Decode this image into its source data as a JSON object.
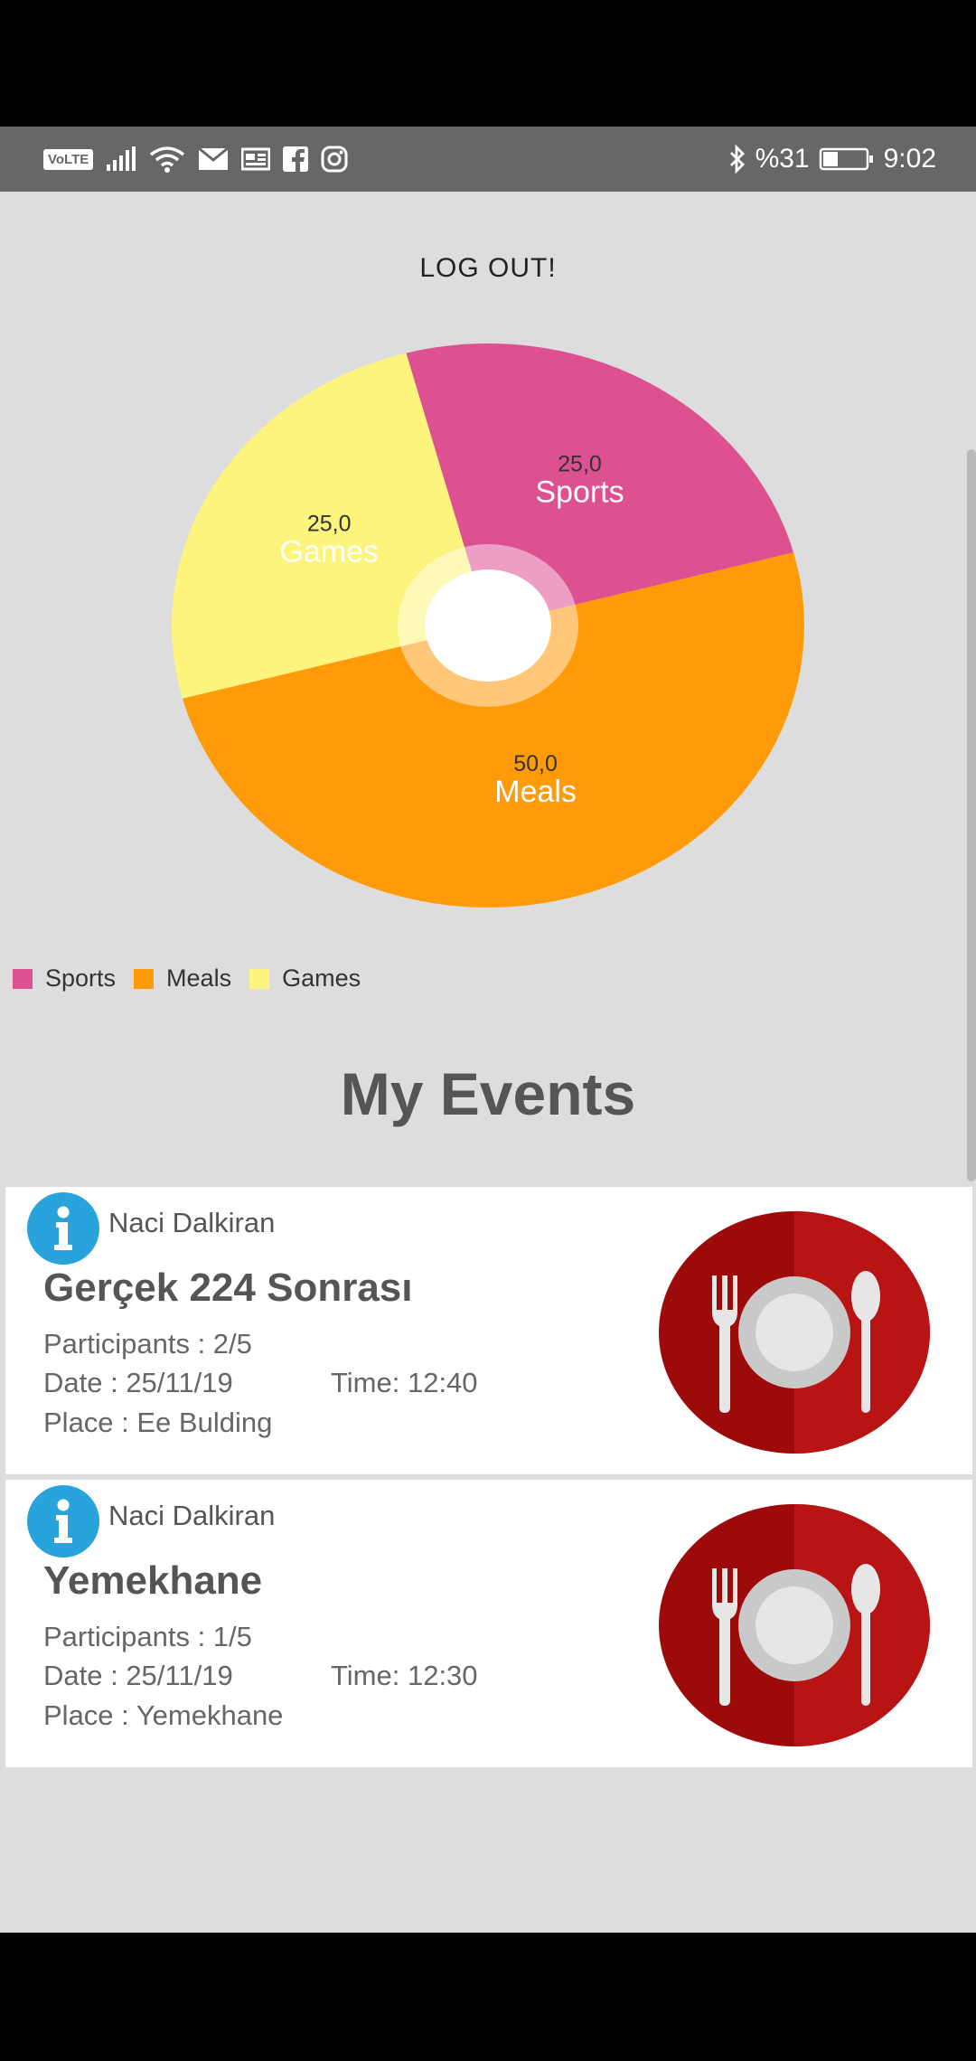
{
  "status_bar": {
    "volte": "VoLTE",
    "battery_percent": "%31",
    "time": "9:02",
    "left_icons": [
      "signal-icon",
      "wifi-icon",
      "mail-icon",
      "news-icon",
      "facebook-icon",
      "instagram-icon"
    ],
    "right_icons": [
      "bluetooth-icon",
      "battery-icon"
    ]
  },
  "header": {
    "logout_label": "LOG OUT!"
  },
  "chart_data": {
    "type": "pie",
    "categories": [
      "Sports",
      "Meals",
      "Games"
    ],
    "values": [
      25.0,
      50.0,
      25.0
    ],
    "value_labels": [
      "25,0",
      "50,0",
      "25,0"
    ],
    "colors": [
      "#dd5190",
      "#ff9a08",
      "#fdf47d"
    ],
    "legend_position": "bottom-left",
    "donut_hole": true
  },
  "legend": {
    "items": [
      {
        "label": "Sports",
        "color": "#dd5190"
      },
      {
        "label": "Meals",
        "color": "#ff9a08"
      },
      {
        "label": "Games",
        "color": "#fdf47d"
      }
    ]
  },
  "events_section": {
    "title": "My Events",
    "events": [
      {
        "organizer": "Naci Dalkiran",
        "title": "Gerçek 224 Sonrası",
        "participants": "Participants : 2/5",
        "date": "Date : 25/11/19",
        "time": "Time: 12:40",
        "place": "Place : Ee Bulding",
        "icon": "meal-plate-icon"
      },
      {
        "organizer": "Naci Dalkiran",
        "title": "Yemekhane",
        "participants": "Participants : 1/5",
        "date": "Date : 25/11/19",
        "time": "Time: 12:30",
        "place": "Place : Yemekhane",
        "icon": "meal-plate-icon"
      }
    ]
  },
  "colors": {
    "status_bar": "#676767",
    "background": "#dddddd",
    "card": "#ffffff",
    "info_icon": "#29a3dc",
    "plate_dark": "#9c0a0a",
    "plate_light": "#b81414"
  }
}
